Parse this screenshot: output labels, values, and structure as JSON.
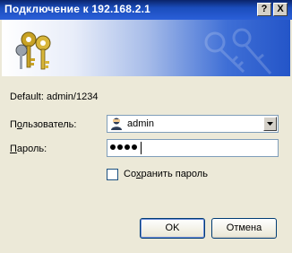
{
  "window": {
    "title": "Подключение к 192.168.2.1",
    "help_glyph": "?",
    "close_glyph": "X"
  },
  "default_hint": "Default: admin/1234",
  "form": {
    "username_label_pre": "П",
    "username_label_acc": "о",
    "username_label_post": "льзователь:",
    "username_value": "admin",
    "password_label_acc": "П",
    "password_label_post": "ароль:",
    "password_value_masked": "••••",
    "remember_label_pre": "Со",
    "remember_label_acc": "х",
    "remember_label_post": "ранить пароль",
    "remember_checked": false
  },
  "buttons": {
    "ok": "OK",
    "cancel": "Отмена"
  },
  "icons": {
    "banner": "keys-icon",
    "user": "user-icon",
    "dropdown": "chevron-down-icon"
  }
}
